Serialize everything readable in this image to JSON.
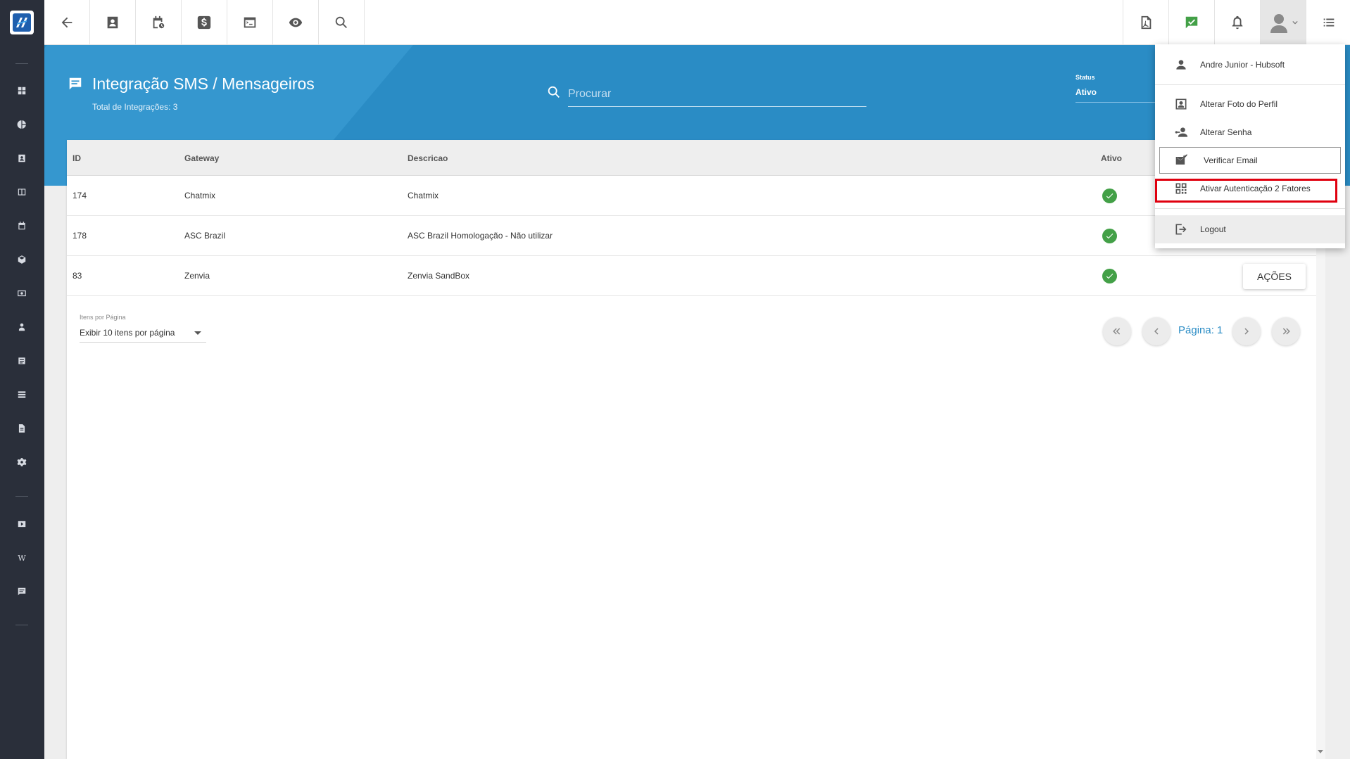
{
  "topbar": {
    "left_icons": [
      "back-arrow-icon",
      "contact-card-icon",
      "calendar-clock-icon",
      "dollar-icon",
      "terminal-icon",
      "eye-icon",
      "search-icon"
    ],
    "right_icons": [
      "pdf-icon",
      "chat-check-icon",
      "bell-icon",
      "user-avatar-icon",
      "list-icon"
    ]
  },
  "sidebar": {
    "icons": [
      "dashboard-icon",
      "pie-chart-icon",
      "contact-icon",
      "book-icon",
      "calendar-icon",
      "cube-icon",
      "cash-icon",
      "user-location-icon",
      "list-icon",
      "server-icon",
      "file-icon",
      "gear-icon",
      "video-icon",
      "wiki-icon",
      "message-icon"
    ],
    "wiki_letter": "W"
  },
  "header": {
    "title": "Integração SMS / Mensageiros",
    "subtitle": "Total de Integrações: 3",
    "search_placeholder": "Procurar",
    "status_label": "Status",
    "status_value": "Ativo"
  },
  "table": {
    "columns": {
      "id": "ID",
      "gateway": "Gateway",
      "descricao": "Descricao",
      "ativo": "Ativo"
    },
    "rows": [
      {
        "id": "174",
        "gateway": "Chatmix",
        "descricao": "Chatmix",
        "ativo": true
      },
      {
        "id": "178",
        "gateway": "ASC Brazil",
        "descricao": "ASC Brazil Homologação - Não utilizar",
        "ativo": true
      },
      {
        "id": "83",
        "gateway": "Zenvia",
        "descricao": "Zenvia SandBox",
        "ativo": true
      }
    ],
    "actions_label": "AÇÕES"
  },
  "pagination": {
    "per_page_label": "Itens por Página",
    "per_page_value": "Exibir 10 itens por página",
    "page_label": "Página: 1"
  },
  "user_menu": {
    "user_name": "Andre Junior - Hubsoft",
    "change_photo": "Alterar Foto do Perfil",
    "change_password": "Alterar Senha",
    "verify_email": "Verificar Email",
    "enable_2fa": "Ativar Autenticação 2 Fatores",
    "logout": "Logout"
  },
  "colors": {
    "sidebar": "#2a2f3a",
    "header_blue": "#2a8cc5",
    "success_green": "#43a047",
    "highlight_red": "#e0000f"
  }
}
